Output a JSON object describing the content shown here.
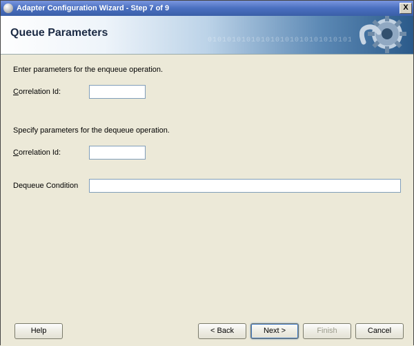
{
  "window": {
    "title": "Adapter Configuration Wizard - Step 7 of 9"
  },
  "banner": {
    "title": "Queue Parameters"
  },
  "content": {
    "enqueue_heading": "Enter parameters for the enqueue operation.",
    "correlation_label_pre": "C",
    "correlation_label_post": "orrelation Id:",
    "enqueue_corr_value": "",
    "dequeue_heading": "Specify parameters for the dequeue operation.",
    "dequeue_corr_value": "",
    "dequeue_cond_label": "Dequeue Condition",
    "dequeue_cond_value": ""
  },
  "buttons": {
    "help": "Help",
    "back": "< Back",
    "next": "Next >",
    "finish": "Finish",
    "cancel": "Cancel"
  }
}
